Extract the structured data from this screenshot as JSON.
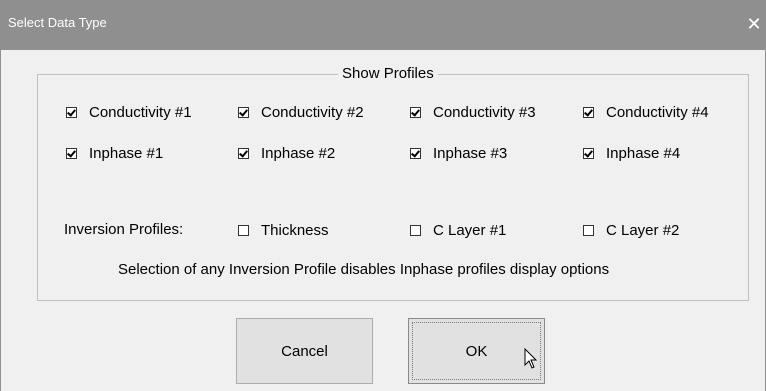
{
  "window": {
    "title": "Select Data Type",
    "close_glyph": "✕"
  },
  "group": {
    "legend": "Show Profiles"
  },
  "profiles_row1": [
    {
      "label": "Conductivity #1",
      "checked": true
    },
    {
      "label": "Conductivity #2",
      "checked": true
    },
    {
      "label": "Conductivity #3",
      "checked": true
    },
    {
      "label": "Conductivity #4",
      "checked": true
    }
  ],
  "profiles_row2": [
    {
      "label": "Inphase #1",
      "checked": true
    },
    {
      "label": "Inphase #2",
      "checked": true
    },
    {
      "label": "Inphase #3",
      "checked": true
    },
    {
      "label": "Inphase #4",
      "checked": true
    }
  ],
  "inversion": {
    "label": "Inversion Profiles:",
    "options": [
      {
        "label": "Thickness",
        "checked": false
      },
      {
        "label": "C Layer #1",
        "checked": false
      },
      {
        "label": "C Layer #2",
        "checked": false
      }
    ],
    "note": "Selection of any Inversion Profile disables Inphase profiles display options"
  },
  "buttons": {
    "cancel": "Cancel",
    "ok": "OK"
  }
}
